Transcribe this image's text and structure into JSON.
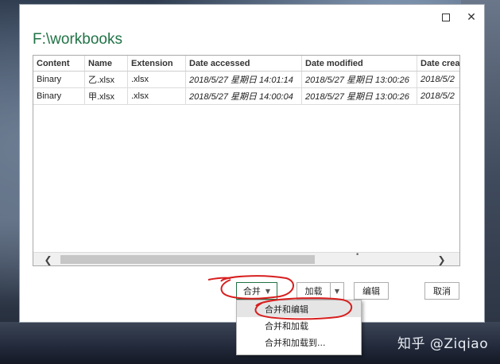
{
  "window": {
    "maximize_glyph": "",
    "close_glyph": "✕"
  },
  "dialog": {
    "title": "F:\\workbooks"
  },
  "table": {
    "columns": [
      "Content",
      "Name",
      "Extension",
      "Date accessed",
      "Date modified",
      "Date crea"
    ],
    "rows": [
      [
        "Binary",
        "乙.xlsx",
        ".xlsx",
        "2018/5/27 星期日 14:01:14",
        "2018/5/27 星期日 13:00:26",
        "2018/5/2"
      ],
      [
        "Binary",
        "甲.xlsx",
        ".xlsx",
        "2018/5/27 星期日 14:00:04",
        "2018/5/27 星期日 13:00:26",
        "2018/5/2"
      ]
    ]
  },
  "buttons": {
    "combine": "合并",
    "load": "加载",
    "edit": "编辑",
    "cancel": "取消"
  },
  "dropdown": {
    "items": [
      "合并和编辑",
      "合并和加载",
      "合并和加载到..."
    ]
  },
  "watermark": "知乎 @Ziqiao",
  "colors": {
    "accent": "#217346",
    "annotation": "#d81e1e"
  }
}
